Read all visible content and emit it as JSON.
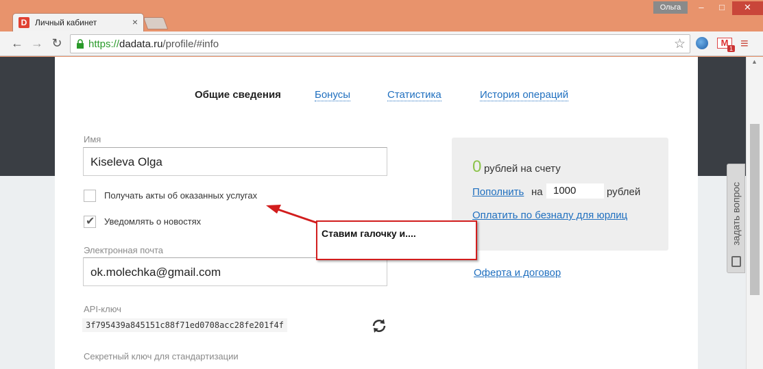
{
  "browser": {
    "tab_title": "Личный кабинет",
    "tab_favicon": "D",
    "tab_close": "×",
    "user_name": "Ольга",
    "url_scheme": "https://",
    "url_host": "dadata.ru",
    "url_path": "/profile/#info",
    "window_min": "–",
    "window_max": "□",
    "window_close": "✕",
    "mail_badge": "1",
    "icons": [
      "back-icon",
      "forward-icon",
      "reload-icon",
      "lock-icon",
      "star-icon",
      "globe-icon",
      "mail-icon",
      "menu-icon"
    ]
  },
  "tabs": {
    "general": "Общие сведения",
    "bonuses": "Бонусы",
    "stats": "Статистика",
    "history": "История операций"
  },
  "form": {
    "name_label": "Имя",
    "name_value": "Kiseleva Olga",
    "acts_checkbox_label": "Получать акты об оказанных услугах",
    "acts_checked": false,
    "news_checkbox_label": "Уведомлять о новостях",
    "news_checked": true,
    "email_label": "Электронная почта",
    "email_value": "ok.molechka@gmail.com",
    "api_label": "API-ключ",
    "api_value": "3f795439a845151c88f71ed0708acc28fe201f4f",
    "secret_label": "Секретный ключ для стандартизации"
  },
  "balance": {
    "amount": "0",
    "text": "рублей на счету",
    "topup_link": "Пополнить",
    "topup_on": "на",
    "topup_value": "1000",
    "currency": "рублей",
    "cashless_link": "Оплатить по безналу для юрлиц",
    "offer_link": "Оферта и договор"
  },
  "annotation": {
    "callout_text": "Ставим галочку и...."
  },
  "feedback": {
    "label": "задать вопрос"
  },
  "colors": {
    "frame": "#e8936c",
    "link": "#1f6fbf",
    "balance_zero": "#8cc34a",
    "callout_border": "#d21d1d"
  }
}
